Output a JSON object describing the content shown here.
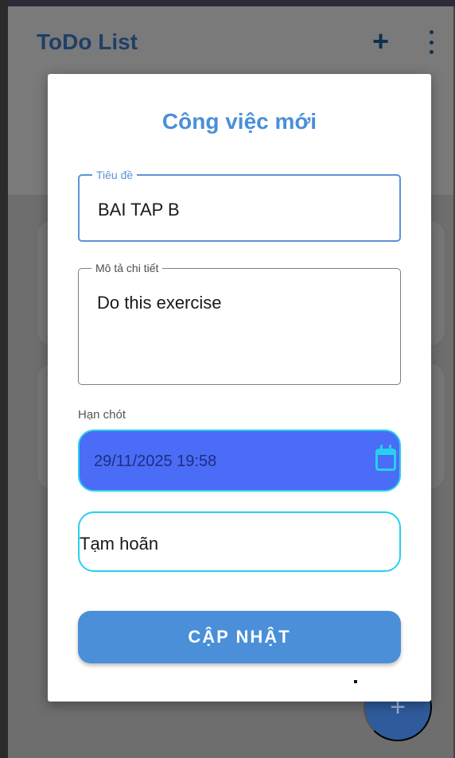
{
  "appbar": {
    "title": "ToDo List",
    "add_icon": "plus-icon",
    "more_icon": "more-vertical-icon"
  },
  "dialog": {
    "title": "Công việc mới",
    "title_field": {
      "label": "Tiêu đề",
      "value": "BAI TAP B"
    },
    "description_field": {
      "label": "Mô tả chi tiết",
      "value": "Do this exercise"
    },
    "deadline": {
      "label": "Hạn chót",
      "value": "29/11/2025 19:58",
      "icon": "calendar-icon"
    },
    "status": {
      "value": "Tạm hoãn"
    },
    "update_button_label": "CẬP NHẬT"
  },
  "fab": {
    "icon": "plus-icon"
  },
  "colors": {
    "primary": "#4a8fd8",
    "date_background": "#4a6cf7",
    "cyan_border": "#27d0ef",
    "overlay": "#7a7a7a"
  }
}
